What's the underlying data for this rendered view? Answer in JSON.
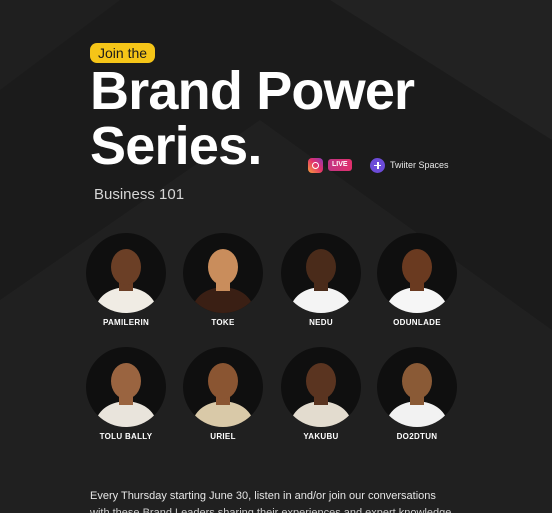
{
  "badge": "Join the",
  "title": {
    "line1": "Brand Power",
    "line2": "Series."
  },
  "subtitle": "Business 101",
  "platforms": [
    {
      "icon": "instagram-icon",
      "label": "LIVE"
    },
    {
      "icon": "twitter-spaces-icon",
      "label": "Twiiter Spaces"
    }
  ],
  "hosts": [
    {
      "name": "PAMILERIN",
      "skin": "#6b3f26",
      "top": "#f0ece4"
    },
    {
      "name": "TOKE",
      "skin": "#c98d5c",
      "top": "#3a1f14"
    },
    {
      "name": "NEDU",
      "skin": "#4a2b1a",
      "top": "#f4f4f4"
    },
    {
      "name": "ODUNLADE",
      "skin": "#6a3a20",
      "top": "#f6f6f6"
    },
    {
      "name": "TOLU BALLY",
      "skin": "#9a6440",
      "top": "#e9e4dc"
    },
    {
      "name": "URIEL",
      "skin": "#8a5532",
      "top": "#d9c9a8"
    },
    {
      "name": "YAKUBU",
      "skin": "#5a3420",
      "top": "#e3dccf"
    },
    {
      "name": "DO2DTUN",
      "skin": "#8a5a36",
      "top": "#f2f2f2"
    }
  ],
  "body": "Every Thursday starting June 30, listen in and/or join our conversations",
  "body_partial": "with these Brand Leaders sharing their experiences and expert knowledge"
}
